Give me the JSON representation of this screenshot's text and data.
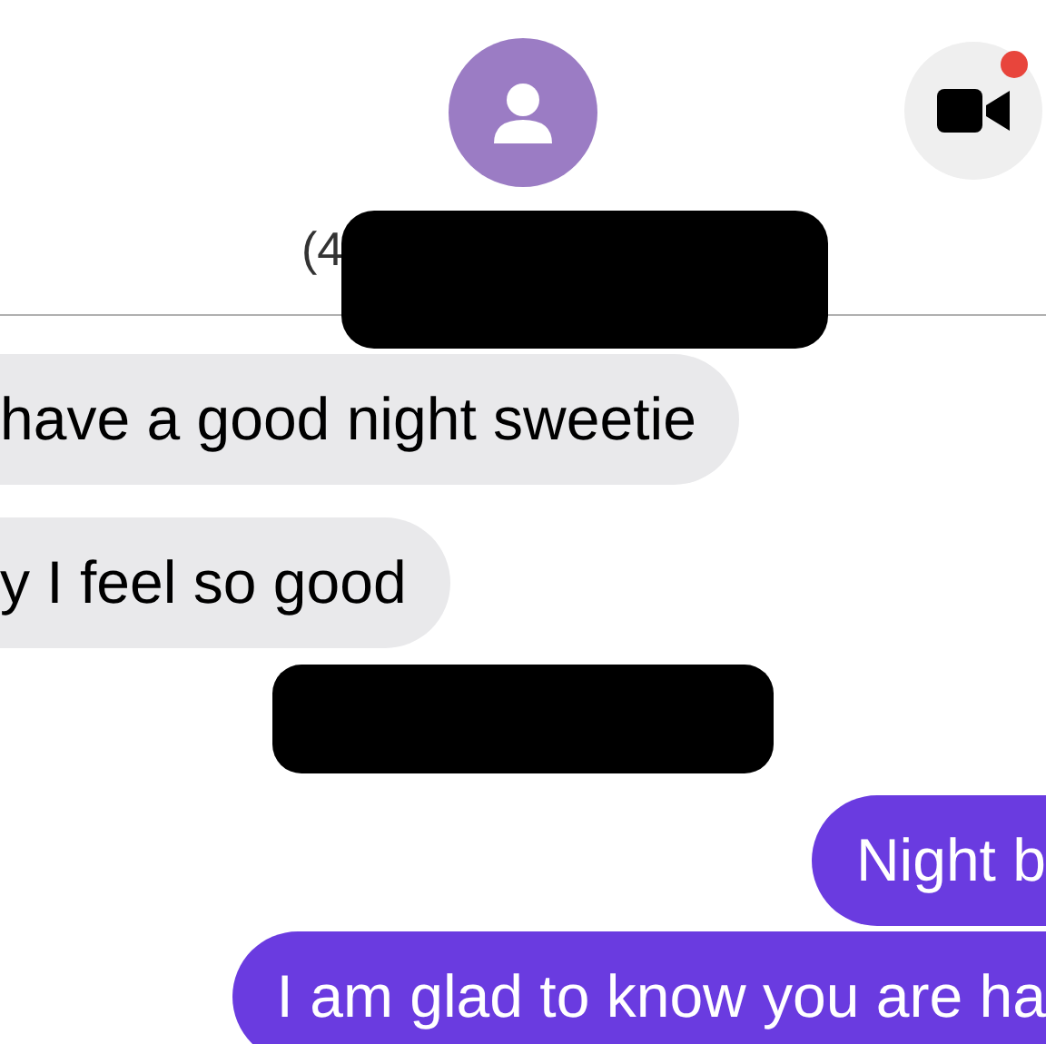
{
  "header": {
    "contact_name": "(4",
    "video_call": {
      "has_notification": true
    }
  },
  "messages": [
    {
      "kind": "incoming",
      "text": "have a good night sweetie"
    },
    {
      "kind": "incoming",
      "text": "y I feel so good"
    },
    {
      "kind": "outgoing",
      "text": "Night b"
    },
    {
      "kind": "outgoing",
      "text": "I am glad to know you are ha"
    }
  ]
}
